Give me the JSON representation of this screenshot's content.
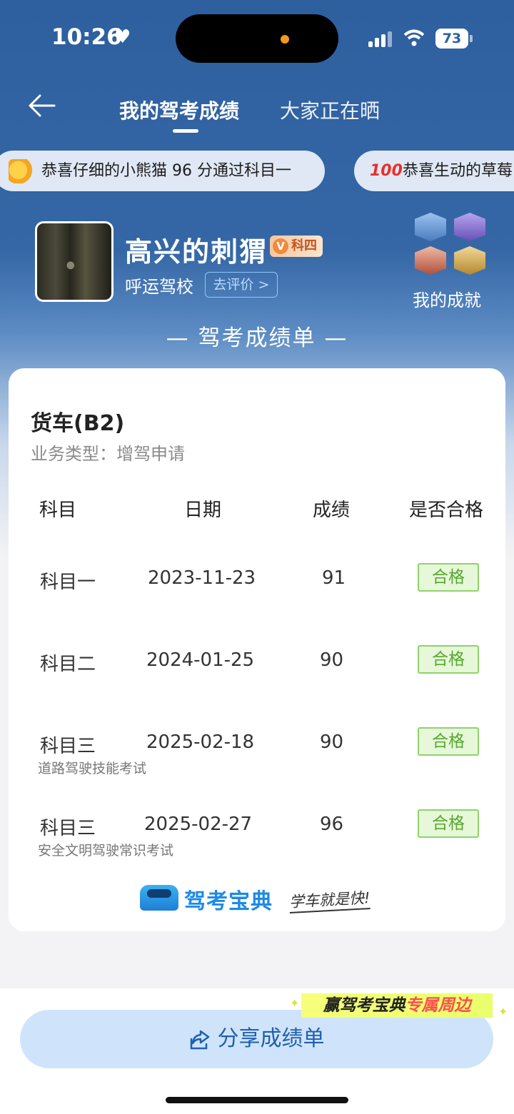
{
  "status_bar": {
    "time": "10:26",
    "battery": "73"
  },
  "nav": {
    "tabs": [
      {
        "label": "我的驾考成绩"
      },
      {
        "label": "大家正在晒"
      }
    ]
  },
  "ticker": [
    {
      "text": "恭喜仔细的小熊猫 96 分通过科目一"
    },
    {
      "text": "恭喜生动的草莓"
    }
  ],
  "profile": {
    "username": "高兴的刺猬",
    "level_badge": "科四",
    "level_badge_v": "V",
    "school": "呼运驾校",
    "review_button": "去评价 >",
    "achievements_label": "我的成就"
  },
  "report_title": "— 驾考成绩单 —",
  "card": {
    "vehicle_type": "货车(B2)",
    "business_type": "业务类型：增驾申请",
    "headers": [
      "科目",
      "日期",
      "成绩",
      "是否合格"
    ],
    "rows": [
      {
        "subject": "科目一",
        "date": "2023-11-23",
        "score": "91",
        "status": "合格",
        "note": ""
      },
      {
        "subject": "科目二",
        "date": "2024-01-25",
        "score": "90",
        "status": "合格",
        "note": ""
      },
      {
        "subject": "科目三",
        "date": "2025-02-18",
        "score": "90",
        "status": "合格",
        "note": "道路驾驶技能考试"
      },
      {
        "subject": "科目三",
        "date": "2025-02-27",
        "score": "96",
        "status": "合格",
        "note": "安全文明驾驶常识考试"
      }
    ],
    "brand_name": "驾考宝典",
    "brand_slogan": "学车就是快!"
  },
  "promo": {
    "prefix": "赢驾考宝典",
    "highlight": "专属周边"
  },
  "share_button": "分享成绩单",
  "colors": {
    "hero_blue": "#2e5f9f",
    "pass_green": "#56a82e",
    "share_bg": "#cfe4fb",
    "brand_blue": "#1f8ae6"
  },
  "icons": [
    "heart-icon",
    "signal-icon",
    "wifi-icon",
    "battery-icon",
    "back-icon",
    "clap-icon",
    "hundred-icon",
    "share-icon"
  ]
}
